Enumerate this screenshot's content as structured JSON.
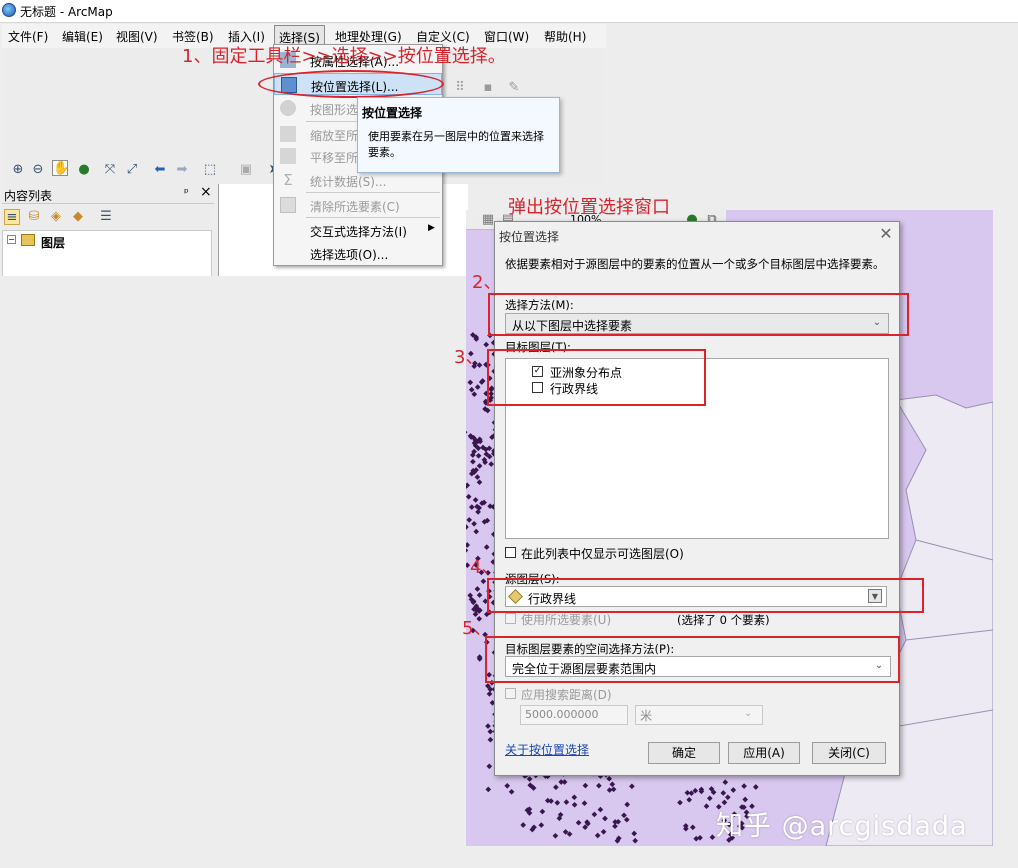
{
  "window": {
    "title": "无标题 - ArcMap"
  },
  "menubar": {
    "items": [
      "文件(F)",
      "编辑(E)",
      "视图(V)",
      "书签(B)",
      "插入(I)",
      "选择(S)",
      "地理处理(G)",
      "自定义(C)",
      "窗口(W)",
      "帮助(H)"
    ]
  },
  "select_menu": {
    "items": [
      {
        "label": "按属性选择(A)...",
        "enabled": true
      },
      {
        "label": "按位置选择(L)...",
        "enabled": true,
        "highlighted": true
      },
      {
        "label": "按图形选",
        "enabled": false
      },
      {
        "label": "缩放至所",
        "enabled": false
      },
      {
        "label": "平移至所",
        "enabled": false
      },
      {
        "label": "统计数据(S)...",
        "enabled": false
      },
      {
        "label": "清除所选要素(C)",
        "enabled": false
      },
      {
        "label": "交互式选择方法(I)",
        "enabled": true,
        "submenu": true
      },
      {
        "label": "选择选项(O)...",
        "enabled": true
      }
    ]
  },
  "tooltip": {
    "title": "按位置选择",
    "description": "使用要素在另一图层中的位置来选择要素。"
  },
  "toc": {
    "title": "内容列表",
    "pin": "ᵖ",
    "close": "×",
    "layers_label": "图层"
  },
  "map_toolbar": {
    "zoom": "100%"
  },
  "dialog": {
    "title": "按位置选择",
    "description": "依据要素相对于源图层中的要素的位置从一个或多个目标图层中选择要素。",
    "method_label": "选择方法(M):",
    "method_value": "从以下图层中选择要素",
    "target_layers_label": "目标图层(T):",
    "target_layers": [
      {
        "name": "亚洲象分布点",
        "checked": true
      },
      {
        "name": "行政界线",
        "checked": false
      }
    ],
    "only_selectable_label": "在此列表中仅显示可选图层(O)",
    "source_label": "源图层(S):",
    "source_value": "行政界线",
    "use_selected_label": "使用所选要素(U)",
    "selected_count": "(选择了 0 个要素)",
    "spatial_method_label": "目标图层要素的空间选择方法(P):",
    "spatial_method_value": "完全位于源图层要素范围内",
    "search_distance_label": "应用搜索距离(D)",
    "distance_value": "5000.000000",
    "distance_unit": "米",
    "about_link": "关于按位置选择",
    "ok": "确定",
    "apply": "应用(A)",
    "close": "关闭(C)"
  },
  "annotations": {
    "step1": "1、固定工具栏>>选择>>按位置选择。",
    "popup_note": "弹出按位置选择窗口",
    "step2": "2、",
    "step3": "3、",
    "step4": "4、",
    "step5": "5、"
  },
  "watermark": "知乎 @arcgisdada",
  "colors": {
    "annotation_red": "#d9232d",
    "map_fill": "#d8c8ef",
    "points": "#3a1650"
  }
}
